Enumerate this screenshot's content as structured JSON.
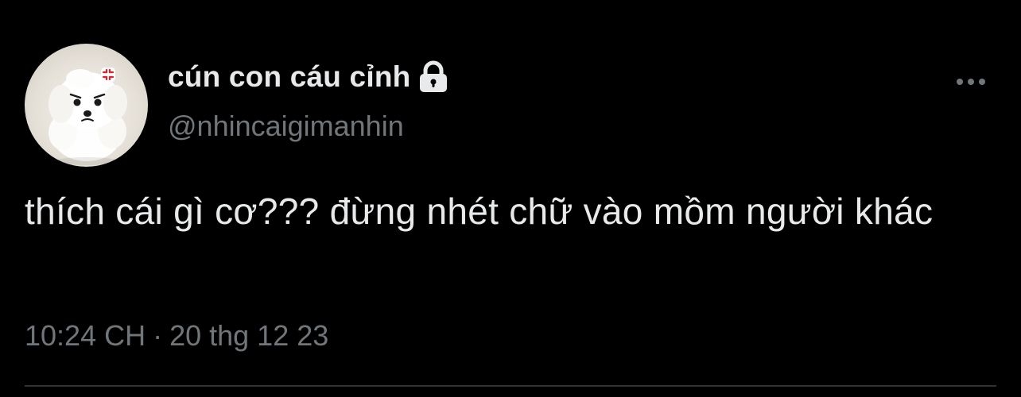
{
  "tweet": {
    "author": {
      "display_name": "cún con cáu cỉnh",
      "handle": "@nhincaigimanhin",
      "protected_icon": "lock-icon",
      "avatar_icon": "avatar-white-puppy"
    },
    "text": "thích cái gì cơ??? đừng nhét chữ vào mồm người khác",
    "time": "10:24 CH",
    "separator": "·",
    "date": "20 thg 12 23",
    "more_icon": "more-options-icon"
  },
  "colors": {
    "background": "#000000",
    "primary_text": "#e7e9ea",
    "secondary_text": "#71767b",
    "divider": "#2f3336"
  }
}
